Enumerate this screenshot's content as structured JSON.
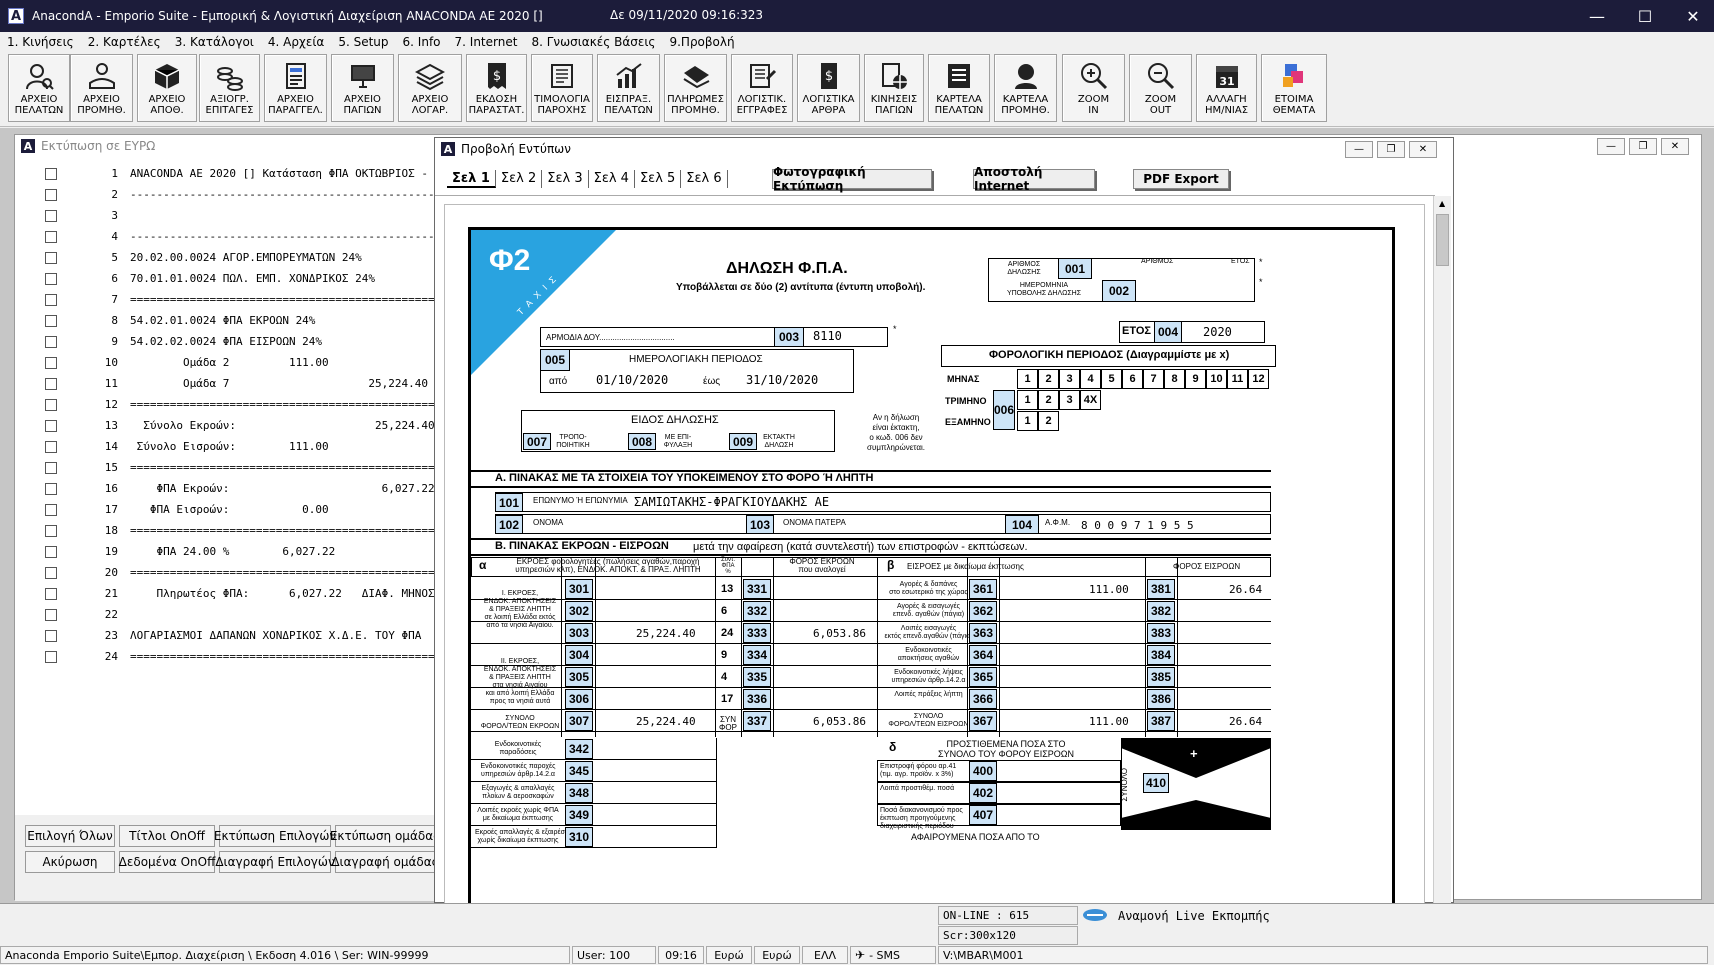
{
  "app": {
    "title": "AnacondA - Emporio Suite - Εμπορική  &  Λογιστική Διαχείριση ANACONDA AE 2020 []",
    "datetime": "Δε  09/11/2020  09:16:323",
    "logo_letter": "A"
  },
  "menu": [
    "1. Κινήσεις",
    "2. Καρτέλες",
    "3. Κατάλογοι",
    "4. Αρχεία",
    "5. Setup",
    "6. Info",
    "7. Internet",
    "8. Γνωσιακές Βάσεις",
    "9.Προβολή"
  ],
  "toolbar": [
    {
      "label": "ΑΡΧΕΙΟ\nΠΕΛΑΤΩΝ",
      "icon": "customer-icon"
    },
    {
      "label": "ΑΡΧΕΙΟ\nΠΡΟΜΗΘ.",
      "icon": "supplier-icon"
    },
    {
      "label": "ΑΡΧΕΙΟ\nΑΠΟΘ.",
      "icon": "warehouse-icon"
    },
    {
      "label": "ΑΞΙΟΓΡ.\nΕΠΙΤΑΓΕΣ",
      "icon": "coins-icon"
    },
    {
      "label": "ΑΡΧΕΙΟ\nΠΑΡΑΓΓΕΛ.",
      "icon": "orders-icon"
    },
    {
      "label": "ΑΡΧΕΙΟ\nΠΑΓΙΩΝ",
      "icon": "monitor-icon"
    },
    {
      "label": "ΑΡΧΕΙΟ\nΛΟΓΑΡ.",
      "icon": "layers-icon"
    },
    {
      "label": "ΕΚΔΟΣΗ\nΠΑΡΑΣΤΑΤ.",
      "icon": "invoice-icon"
    },
    {
      "label": "ΤΙΜΟΛΟΓΙΑ\nΠΑΡΟΧΗΣ",
      "icon": "scroll-icon"
    },
    {
      "label": "ΕΙΣΠΡΑΞ.\nΠΕΛΑΤΩΝ",
      "icon": "chart-icon"
    },
    {
      "label": "ΠΛΗΡΩΜΕΣ\nΠΡΟΜΗΘ.",
      "icon": "payment-icon"
    },
    {
      "label": "ΛΟΓΙΣΤΙΚ.\nΕΓΓΡΑΦΕΣ",
      "icon": "register-icon"
    },
    {
      "label": "ΛΟΓΙΣΤΙΚΑ\nΑΡΘΡΑ",
      "icon": "ledger-icon"
    },
    {
      "label": "ΚΙΝΗΣΕΙΣ\nΠΑΓΙΩΝ",
      "icon": "assets-icon"
    },
    {
      "label": "ΚΑΡΤΕΛΑ\nΠΕΛΑΤΩΝ",
      "icon": "card-icon"
    },
    {
      "label": "ΚΑΡΤΕΛΑ\nΠΡΟΜΗΘ.",
      "icon": "person-card-icon"
    },
    {
      "label": "ZOOM\nIN",
      "icon": "zoom-in-icon"
    },
    {
      "label": "ZOOM\nOUT",
      "icon": "zoom-out-icon"
    },
    {
      "label": "ΑΛΛΑΓΗ\nΗΜ/ΝΙΑΣ",
      "icon": "calendar-icon"
    },
    {
      "label": "ΕΤΟΙΜΑ\nΘΕΜΑΤΑ",
      "icon": "themes-icon"
    }
  ],
  "calendar_day": "31",
  "print_window": {
    "title": "Εκτύπωση σε ΕΥΡΩ",
    "lines": [
      {
        "n": "1",
        "t": "ANACONDA AE 2020 [] Κατάσταση ΦΠΑ ΟΚΤΩΒΡΙΟΣ -"
      },
      {
        "n": "2",
        "t": "--------------------------------------------------"
      },
      {
        "n": "3",
        "t": ""
      },
      {
        "n": "4",
        "t": "--------------------------------------------------"
      },
      {
        "n": "5",
        "t": "20.02.00.0024 ΑΓΟΡ.ΕΜΠΟΡΕΥΜΑΤΩΝ 24%"
      },
      {
        "n": "6",
        "t": "70.01.01.0024 ΠΩΛ. ΕΜΠ. ΧΟΝΔΡΙΚΟΣ 24%"
      },
      {
        "n": "7",
        "t": "=================================================="
      },
      {
        "n": "8",
        "t": "54.02.01.0024 ΦΠΑ ΕΚΡΟΩΝ 24%"
      },
      {
        "n": "9",
        "t": "54.02.02.0024 ΦΠΑ ΕΙΣΡΟΩΝ 24%"
      },
      {
        "n": "10",
        "t": "        Ομάδα 2         111.00"
      },
      {
        "n": "11",
        "t": "        Ομάδα 7                     25,224.40"
      },
      {
        "n": "12",
        "t": "=================================================="
      },
      {
        "n": "13",
        "t": "  Σύνολο Εκροών:                     25,224.40"
      },
      {
        "n": "14",
        "t": " Σύνολο Εισροών:        111.00"
      },
      {
        "n": "15",
        "t": "=================================================="
      },
      {
        "n": "16",
        "t": "    ΦΠΑ Εκροών:                       6,027.22"
      },
      {
        "n": "17",
        "t": "   ΦΠΑ Εισροών:           0.00"
      },
      {
        "n": "18",
        "t": "=================================================="
      },
      {
        "n": "19",
        "t": "    ΦΠΑ 24.00 %        6,027.22"
      },
      {
        "n": "20",
        "t": "=================================================="
      },
      {
        "n": "21",
        "t": "    Πληρωτέος ΦΠΑ:      6,027.22   ΔΙΑΦ. ΜΗΝΟΣ"
      },
      {
        "n": "22",
        "t": ""
      },
      {
        "n": "23",
        "t": "ΛΟΓΑΡΙΑΣΜΟΙ ΔΑΠΑΝΩΝ ΧΟΝΔΡΙΚΟΣ Χ.Δ.Ε. ΤΟΥ ΦΠΑ"
      },
      {
        "n": "24",
        "t": "=================================================="
      }
    ],
    "buttons_row1": [
      "Επιλογή Όλων",
      "Τίτλοι OnOff",
      "Εκτύπωση Επιλογών",
      "Εκτύπωση ομάδας"
    ],
    "buttons_row2": [
      "Ακύρωση",
      "Δεδομένα OnOff",
      "Διαγραφή Επιλογών",
      "Διαγραφή ομάδας"
    ]
  },
  "preview_window": {
    "title": "Προβολή Εντύπων",
    "tabs": [
      "Σελ 1",
      "Σελ 2",
      "Σελ 3",
      "Σελ 4",
      "Σελ 5",
      "Σελ 6"
    ],
    "btn_photo": "Φωτογραφική Εκτύπωση",
    "btn_internet": "Αποστολή Internet",
    "btn_pdf": "PDF Export"
  },
  "form": {
    "phi": "Φ2",
    "taxis": "Τ Α Χ Ι Σ",
    "title": "ΔΗΛΩΣΗ Φ.Π.Α.",
    "subtitle": "Υποβάλλεται σε δύο (2) αντίτυπα (έντυπη υποβολή).",
    "arithmos_label": "ΑΡΙΘΜΟΣ\nΔΗΛΩΣΗΣ",
    "arithmos_head": "ΑΡΙΘΜΟΣ",
    "etos_head": "ΕΤΟΣ",
    "date_label": "ΗΜΕΡΟΜΗΝΙΑ\nΥΠΟΒΟΛΗΣ ΔΗΛΩΣΗΣ",
    "star": "*",
    "armodia_label": "ΑΡΜΟΔΙΑ ΔΟΥ..................................",
    "doy_value": "8110",
    "etos_label": "ΕΤΟΣ",
    "etos_value": "2020",
    "hmer_period": "ΗΜΕΡΟΛΟΓΙΑΚΗ ΠΕΡΙΟΔΟΣ",
    "apo": "από",
    "apo_value": "01/10/2020",
    "eos": "έως",
    "eos_value": "31/10/2020",
    "fp_title": "ΦΟΡΟΛΟΓΙΚΗ ΠΕΡΙΟΔΟΣ (Διαγραμμίστε με x)",
    "minas": "ΜΗΝΑΣ",
    "trimino": "ΤΡΙΜΗΝΟ",
    "examino": "ΕΞΑΜΗΝΟ",
    "months": [
      "1",
      "2",
      "3",
      "4",
      "5",
      "6",
      "7",
      "8",
      "9",
      "10",
      "11",
      "12"
    ],
    "quarters": [
      "1",
      "2",
      "3",
      "4Χ"
    ],
    "halves": [
      "1",
      "2"
    ],
    "eidos": "ΕΙΔΟΣ  ΔΗΛΩΣΗΣ",
    "tropo": "ΤΡΟΠΟ-\nΠΟΙΗΤΙΚΗ",
    "me_epi": "ΜΕ ΕΠΙ-\nΦΥΛΑΞΗ",
    "ektakti": "ΕΚΤΑΚΤΗ\nΔΗΛΩΣΗ",
    "note": "Αν η δήλωση\nείναι έκτακτη,\nο κωδ. 006 δεν\nσυμπληρώνεται.",
    "sectionA": "Α. ΠΙΝΑΚΑΣ ΜΕ ΤΑ ΣΤΟΙΧΕΙΑ ΤΟΥ ΥΠΟΚΕΙΜΕΝΟΥ ΣΤΟ ΦΟΡΟ Ή ΛΗΠΤΗ",
    "eponymo_label": "ΕΠΩΝΥΜΟ Ή ΕΠΩΝΥΜΙΑ",
    "eponymo_value": "ΣΑΜΙΩΤΑΚΗΣ-ΦΡΑΓΚΙΟΥΔΑΚΗΣ ΑΕ",
    "onoma_label": "ΟΝΟΜΑ",
    "onoma_patera_label": "ΟΝΟΜΑ ΠΑΤΕΡΑ",
    "afm_label": "Α.Φ.Μ.",
    "afm_value": "8 0 0 9 7 1 9 5 5",
    "sectionB": "Β. ΠΙΝΑΚΑΣ ΕΚΡΟΩΝ - ΕΙΣΡΟΩΝ",
    "sectionB_sub": "μετά την αφαίρεση (κατά συντελεστή) των επιστροφών - εκπτώσεων.",
    "alpha": "α",
    "beta": "β",
    "delta": "δ",
    "col_ekroes": "ΕΚΡΟΕΣ φορολογητέες (πωλήσεις αγαθών,παροχή\nυπηρεσιών κλπ), ΕΝΔΟΚ. ΑΠΟΚΤ. & ΠΡΑΞ. ΛΗΠΤΗ",
    "col_synt": "Συντ.\nΦΠΑ\n%",
    "col_foros_ekr": "ΦΟΡΟΣ ΕΚΡΟΩΝ\nπου αναλογεί",
    "col_eisroes": "ΕΙΣΡΟΕΣ με δικαίωμα έκπτωσης",
    "col_foros_eis": "ΦΟΡΟΣ ΕΙΣΡΟΩΝ",
    "grpI": "Ι. ΕΚΡΟΕΣ,\nΕΝΔΟΚ. ΑΠΟΚΤΗΣΕΙΣ\n& ΠΡΑΞΕΙΣ ΛΗΠΤΗ\nσε λοιπή Ελλάδα εκτός\nαπό τα νησιά Αιγαίου.",
    "grpII": "ΙΙ. ΕΚΡΟΕΣ,\nΕΝΔΟΚ. ΑΠΟΚΤΗΣΕΙΣ\n& ΠΡΑΞΕΙΣ ΛΗΠΤΗ\nστα νησιά Αιγαίου\nκαι από λοιπή Ελλάδα\nπρος τα νησιά αυτά",
    "synolo_ekr": "ΣΥΝΟΛΟ\nΦΟΡΟΛ/ΤΕΩΝ ΕΚΡΟΩΝ",
    "synfor": "ΣΥΝ\nΦΟΡ",
    "rows": [
      {
        "c1": "301",
        "v1": "",
        "r": "13",
        "c2": "331",
        "v2": "",
        "d": "Αγορές & δαπάνες\nστο εσωτερικό της χώρας",
        "c3": "361",
        "v3": "111.00",
        "c4": "381",
        "v4": "26.64"
      },
      {
        "c1": "302",
        "v1": "",
        "r": "6",
        "c2": "332",
        "v2": "",
        "d": "Αγορές & εισαγωγές\nεπενδ. αγαθών (πάγια)",
        "c3": "362",
        "v3": "",
        "c4": "382",
        "v4": ""
      },
      {
        "c1": "303",
        "v1": "25,224.40",
        "r": "24",
        "c2": "333",
        "v2": "6,053.86",
        "d": "Λοιπές εισαγωγές\nεκτός επενδ.αγαθών (πάγια)",
        "c3": "363",
        "v3": "",
        "c4": "383",
        "v4": ""
      },
      {
        "c1": "304",
        "v1": "",
        "r": "9",
        "c2": "334",
        "v2": "",
        "d": "Ενδοκοινοτικές\nαποκτήσεις αγαθών",
        "c3": "364",
        "v3": "",
        "c4": "384",
        "v4": ""
      },
      {
        "c1": "305",
        "v1": "",
        "r": "4",
        "c2": "335",
        "v2": "",
        "d": "Ενδοκοινοτικές λήψεις\nυπηρεσιών άρθρ.14.2.α",
        "c3": "365",
        "v3": "",
        "c4": "385",
        "v4": ""
      },
      {
        "c1": "306",
        "v1": "",
        "r": "17",
        "c2": "336",
        "v2": "",
        "d": "Λοιπές πράξεις λήπτη",
        "c3": "366",
        "v3": "",
        "c4": "386",
        "v4": ""
      },
      {
        "c1": "307",
        "v1": "25,224.40",
        "r": "",
        "c2": "337",
        "v2": "6,053.86",
        "d": "ΣΥΝΟΛΟ\nΦΟΡΟΛ/ΤΕΩΝ ΕΙΣΡΟΩΝ",
        "c3": "367",
        "v3": "111.00",
        "c4": "387",
        "v4": "26.64"
      }
    ],
    "lower_rows": [
      {
        "d": "Ενδοκοινοτικές\nπαραδόσεις",
        "c": "342"
      },
      {
        "d": "Ενδοκοινοτικές παροχές\nυπηρεσιών άρθρ.14.2.α",
        "c": "345"
      },
      {
        "d": "Εξαγωγές & απαλλαγές\nπλοίων & αεροσκαφών",
        "c": "348"
      },
      {
        "d": "Λοιπές εκροές χωρίς ΦΠΑ\nμε δικαίωμα έκπτωσης",
        "c": "349"
      },
      {
        "d": "Εκροές απαλλαγές & εξαιρέσεις\nχωρίς δικαίωμα έκπτωσης",
        "c": "310"
      }
    ],
    "prostithemena": "ΠΡΟΣΤΙΘΕΜΕΝΑ ΠΟΣΑ ΣΤΟ\nΣΥΝΟΛΟ ΤΟΥ ΦΟΡΟΥ ΕΙΣΡΟΩΝ",
    "delta_rows": [
      {
        "d": "Επιστροφή φόρου αρ.41\n(τιμ. αγρ. προϊόν. x 3%)",
        "c": "400"
      },
      {
        "d": "Λοιπά προστιθέμ. ποσά",
        "c": "402"
      },
      {
        "d": "Ποσά διακανονισμού προς\nέκπτωση προηγούμενης\nδιαχειριστικής περιόδου",
        "c": "407"
      }
    ],
    "synolo_vert": "ΣΥΝΟΛΟ",
    "c410": "410",
    "plus": "+",
    "minus": "−",
    "afairoumena": "ΑΦΑΙΡΟΥΜΕΝΑ ΠΟΣΑ ΑΠΟ ΤΟ",
    "codes": {
      "c001": "001",
      "c002": "002",
      "c003": "003",
      "c004": "004",
      "c005": "005",
      "c006": "006",
      "c007": "007",
      "c008": "008",
      "c009": "009",
      "c101": "101",
      "c102": "102",
      "c103": "103",
      "c104": "104"
    }
  },
  "online": {
    "online_text": "ON-LINE : 615",
    "scr_text": "Scr:300x120",
    "live_text": "Αναμονή Live Εκπομπής"
  },
  "statusbar": {
    "path": "Anaconda Emporio Suite\\Εμπορ. Διαχείριση \\ Εκδοση 4.016 \\ Ser: WIN-99999",
    "user": "User: 100",
    "time": "09:16",
    "cur1": "Ευρώ",
    "cur2": "Ευρώ",
    "lang": "ΕΛΛ",
    "sms": "- SMS",
    "drive": "V:\\MBAR\\M001"
  },
  "colors": {
    "titlebar": "#1c1c3a",
    "code_fill": "#cde4f7",
    "corner": "#29a3e0",
    "mdi_bg": "#c6c6c6"
  }
}
